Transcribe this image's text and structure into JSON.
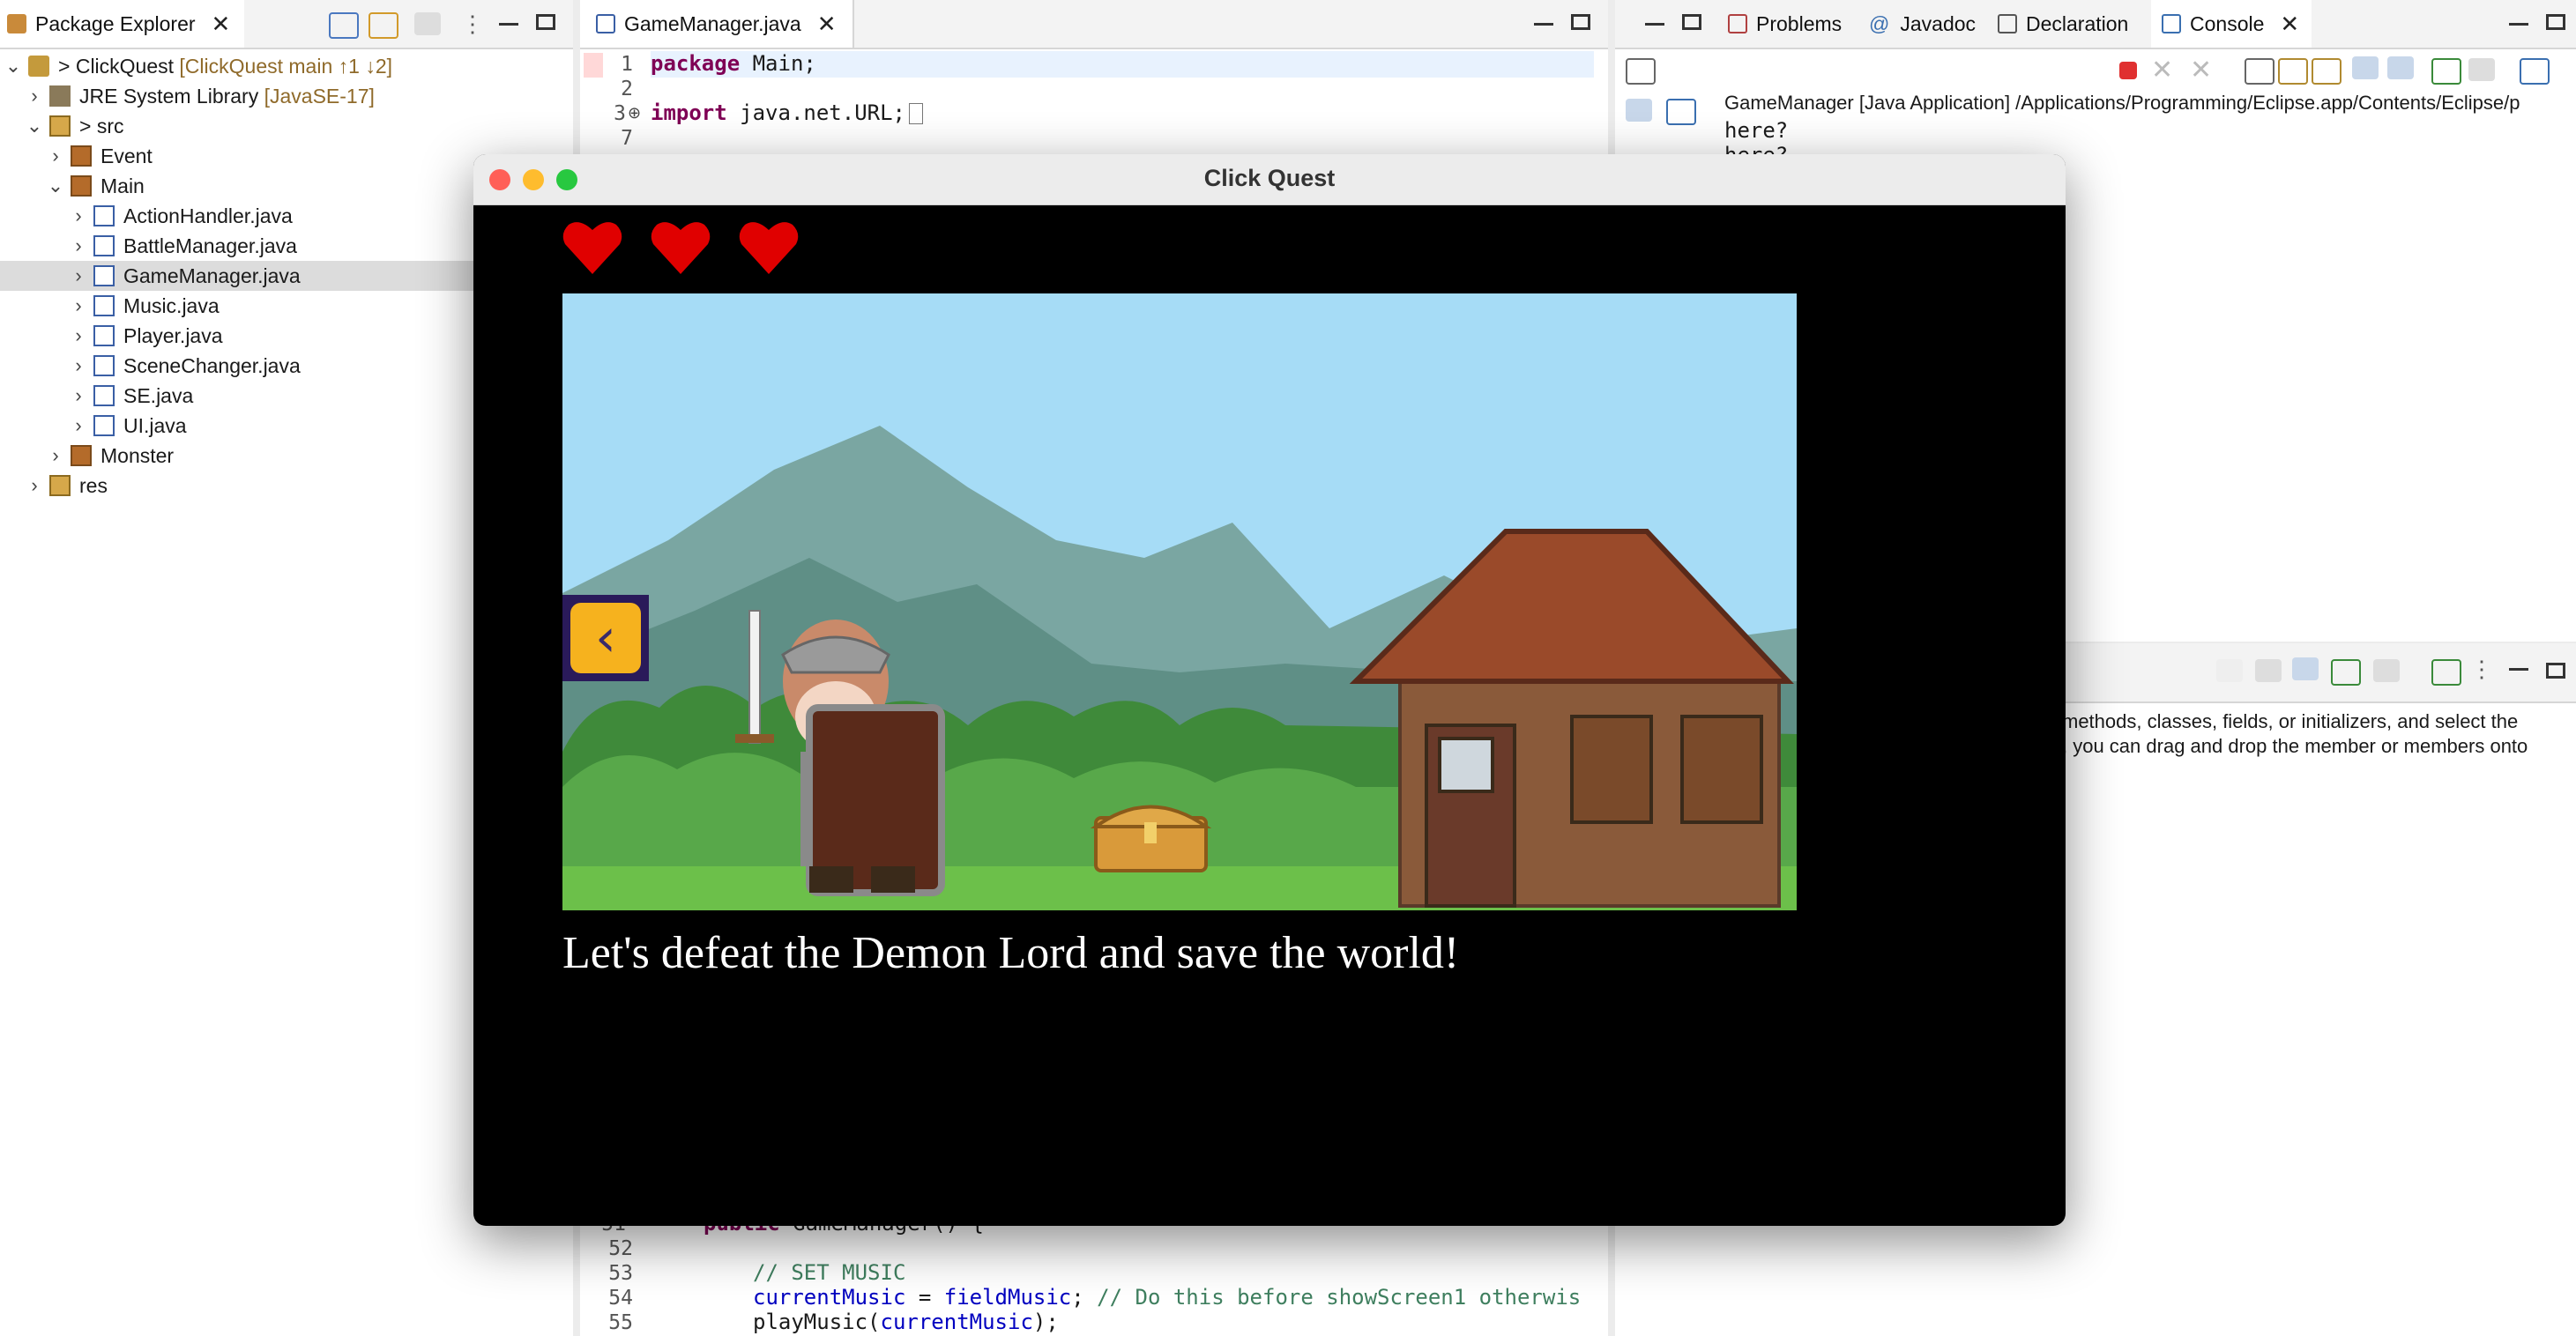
{
  "package_explorer": {
    "tab_label": "Package Explorer",
    "project": {
      "name": "ClickQuest",
      "decoration": "[ClickQuest main ↑1 ↓2]",
      "dirty_marker": ">"
    },
    "library": {
      "name": "JRE System Library",
      "decoration": "[JavaSE-17]"
    },
    "src": {
      "name": "src",
      "dirty_marker": ">"
    },
    "packages": {
      "event": "Event",
      "main": "Main",
      "monster": "Monster"
    },
    "files": [
      "ActionHandler.java",
      "BattleManager.java",
      "GameManager.java",
      "Music.java",
      "Player.java",
      "SceneChanger.java",
      "SE.java",
      "UI.java"
    ],
    "res": "res"
  },
  "editor": {
    "tab_label": "GameManager.java",
    "line_numbers": {
      "l1": "1",
      "l2": "2",
      "l3": "3",
      "l7": "7",
      "l51": "51",
      "l52": "52",
      "l53": "53",
      "l54": "54",
      "l55": "55"
    },
    "code": {
      "l1_kw": "package",
      "l1_rest": " Main;",
      "l3_kw": "import",
      "l3_rest": " java.net.URL;",
      "l51_kw": "public",
      "l51_rest": " GameManager() {",
      "l53": "// SET MUSIC",
      "l54_field": "currentMusic",
      "l54_mid": " = ",
      "l54_field2": "fieldMusic",
      "l54_semi": "; ",
      "l54_comment": "// Do this before showScreen1 otherwis",
      "l55_call": "playMusic(",
      "l55_field": "currentMusic",
      "l55_end": ");"
    }
  },
  "console_panel": {
    "tabs": {
      "problems": "Problems",
      "javadoc": "Javadoc",
      "declaration": "Declaration",
      "console": "Console"
    },
    "javadoc_at": "@",
    "launch_info": "GameManager [Java Application] /Applications/Programming/Eclipse.app/Contents/Eclipse/p",
    "lines": [
      "here?",
      "here?"
    ]
  },
  "outline_panel": {
    "hint_line1": "methods, classes, fields, or initializers, and select the",
    "hint_line2": ", you can drag and drop the member or members onto"
  },
  "game_window": {
    "title": "Click Quest",
    "hearts": 3,
    "message": "Let's defeat the Demon Lord and save the world!",
    "colors": {
      "sky": "#a6dcf6",
      "grass": "#6cc04a",
      "heart": "#e00000",
      "arrow_button": "#f6b21e"
    }
  }
}
